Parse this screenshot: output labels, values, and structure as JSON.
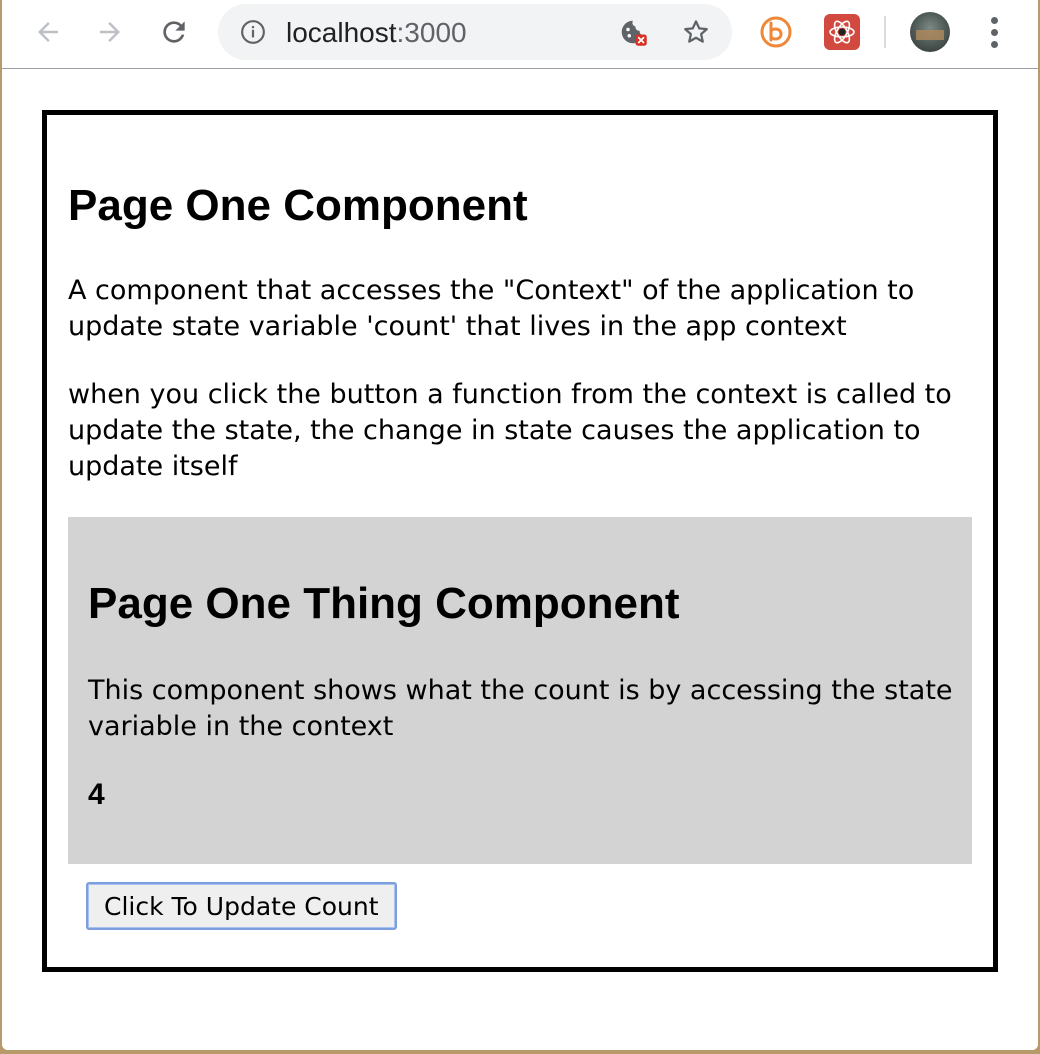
{
  "browser": {
    "url_host": "localhost",
    "url_port": ":3000",
    "icons": {
      "back": "arrow-left-icon",
      "forward": "arrow-right-icon",
      "reload": "reload-icon",
      "site_info": "info-icon",
      "cookies_blocked": "cookie-blocked-icon",
      "bookmark": "star-icon",
      "extension_1": "b-extension-icon",
      "extension_2": "react-devtools-icon",
      "profile": "avatar",
      "menu": "more-vertical-icon"
    }
  },
  "page_one": {
    "title": "Page One Component",
    "description_1": "A component that accesses the \"Context\" of the application to update state variable 'count' that lives in the app context",
    "description_2": "when you click the button a function from the context is called to update the state, the change in state causes the application to update itself",
    "button_label": "Click To Update Count"
  },
  "page_one_thing": {
    "title": "Page One Thing Component",
    "description": "This component shows what the count is by accessing the state variable in the context",
    "count": "4",
    "background": "#d3d3d3"
  }
}
